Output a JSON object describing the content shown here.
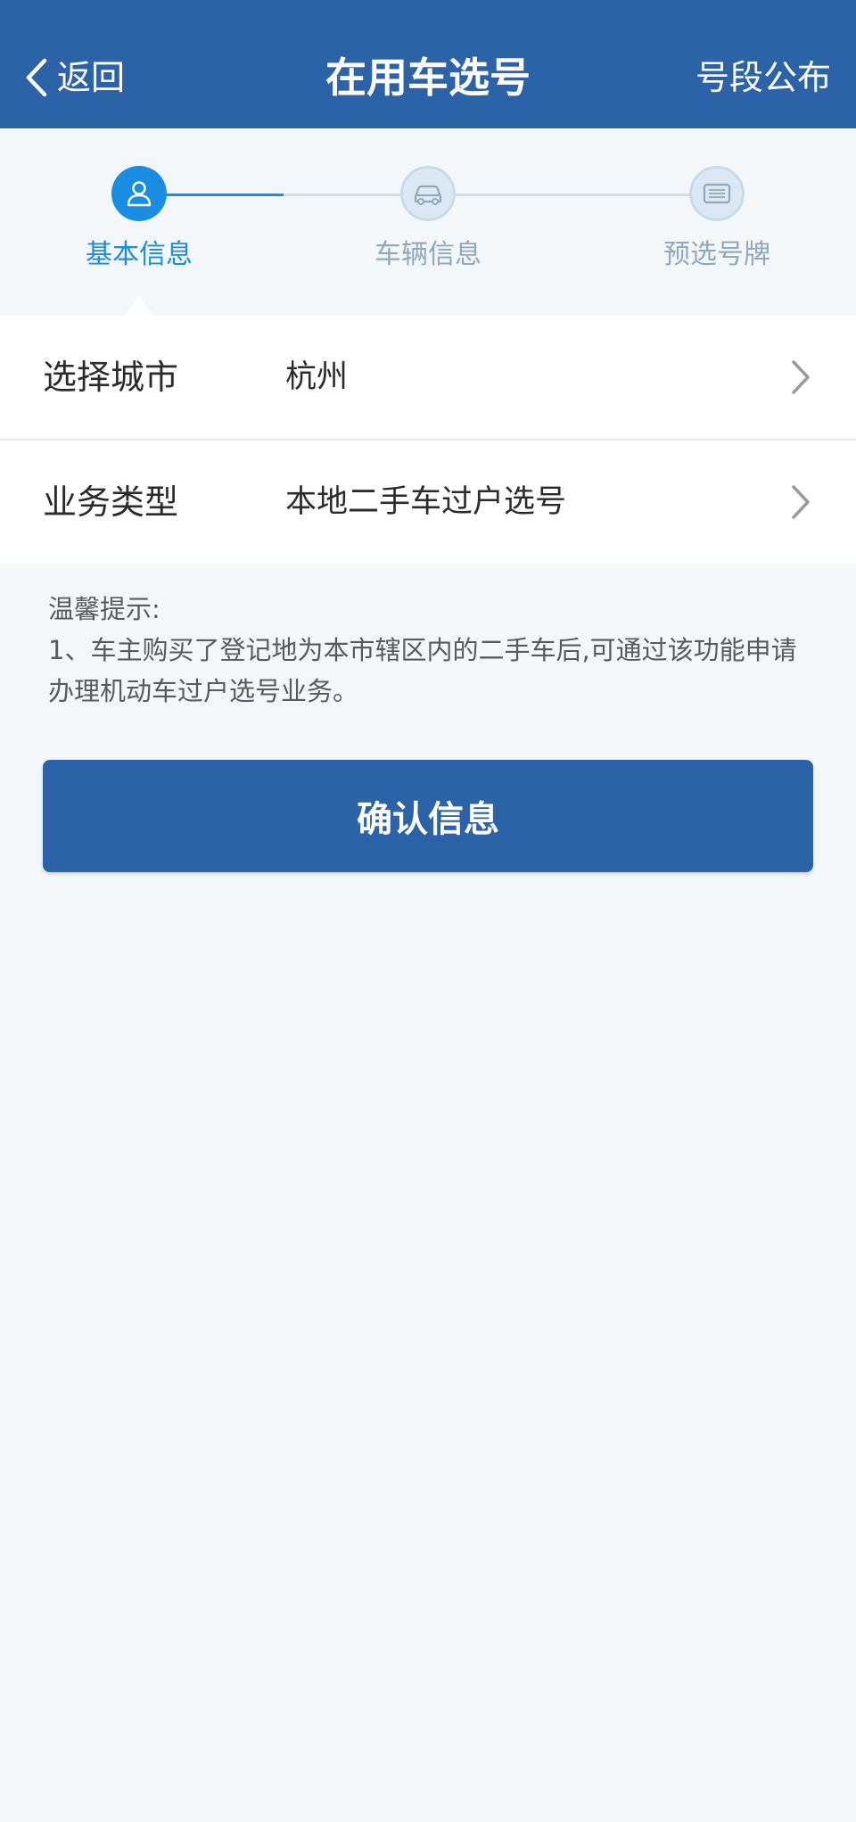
{
  "header": {
    "back_label": "返回",
    "title": "在用车选号",
    "right_link": "号段公布"
  },
  "steps": [
    {
      "label": "基本信息",
      "icon": "user-icon",
      "active": true
    },
    {
      "label": "车辆信息",
      "icon": "car-icon",
      "active": false
    },
    {
      "label": "预选号牌",
      "icon": "license-plate-icon",
      "active": false
    }
  ],
  "form": {
    "city": {
      "label": "选择城市",
      "value": "杭州"
    },
    "business_type": {
      "label": "业务类型",
      "value": "本地二手车过户选号"
    }
  },
  "tips": {
    "title": "温馨提示:",
    "line1": "1、车主购买了登记地为本市辖区内的二手车后,可通过该功能申请办理机动车过户选号业务。"
  },
  "confirm_button": "确认信息",
  "colors": {
    "primary": "#2c63a8",
    "accent": "#1a8de3",
    "background": "#f3f7fa"
  }
}
